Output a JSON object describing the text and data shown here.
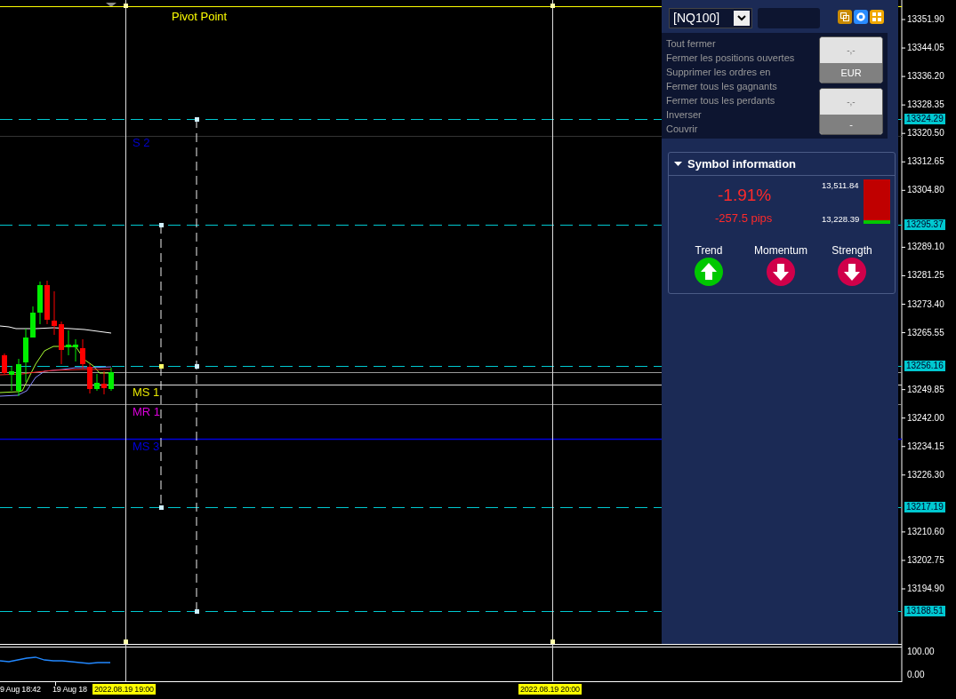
{
  "chart": {
    "price_ticks": [
      "13351.90",
      "13344.05",
      "13336.20",
      "13328.35",
      "13320.50",
      "13312.65",
      "13304.80",
      "13289.10",
      "13281.25",
      "13273.40",
      "13265.55",
      "13249.85",
      "13242.00",
      "13234.15",
      "13226.30",
      "13210.60",
      "13202.75",
      "13194.90"
    ],
    "price_tags": [
      "13324.29",
      "13295.37",
      "13256.16",
      "13217.19",
      "13188.51"
    ],
    "levels": [
      {
        "label": "Pivot Point",
        "color": "#ffff00"
      },
      {
        "label": "S 2",
        "color": "#0000cc"
      },
      {
        "label": "MS 1",
        "color": "#e8e800"
      },
      {
        "label": "MR 1",
        "color": "#dd00dd"
      },
      {
        "label": "MS 3",
        "color": "#0000dd"
      }
    ],
    "time_labels": [
      {
        "text": "9 Aug 18:42",
        "kind": "plain"
      },
      {
        "text": "19 Aug 18",
        "kind": "plain"
      },
      {
        "text": "2022.08.19 19:00",
        "kind": "highlight"
      },
      {
        "text": "2022.08.19 20:00",
        "kind": "highlight"
      }
    ]
  },
  "indicator": {
    "ticks": [
      "100.00",
      "0.00"
    ]
  },
  "panel": {
    "symbol": "[NQ100]",
    "actions": [
      "Tout fermer",
      "Fermer les positions ouvertes",
      "Supprimer les ordres en",
      "Fermer tous les gagnants",
      "Fermer tous les perdants",
      "Inverser",
      "Couvrir"
    ],
    "buttons": [
      {
        "value": "-,-",
        "caption": "EUR"
      },
      {
        "value": "-,-",
        "caption": "-"
      }
    ],
    "symbol_info": {
      "title": "Symbol information",
      "expanded": true,
      "change_percent": "-1.91%",
      "change_pips": "-257.5 pips",
      "high": "13,511.84",
      "low": "13,228.39",
      "level": 0.08,
      "signals": [
        {
          "label": "Trend",
          "kind": "up"
        },
        {
          "label": "Momentum",
          "kind": "down"
        },
        {
          "label": "Strength",
          "kind": "down"
        }
      ]
    }
  }
}
